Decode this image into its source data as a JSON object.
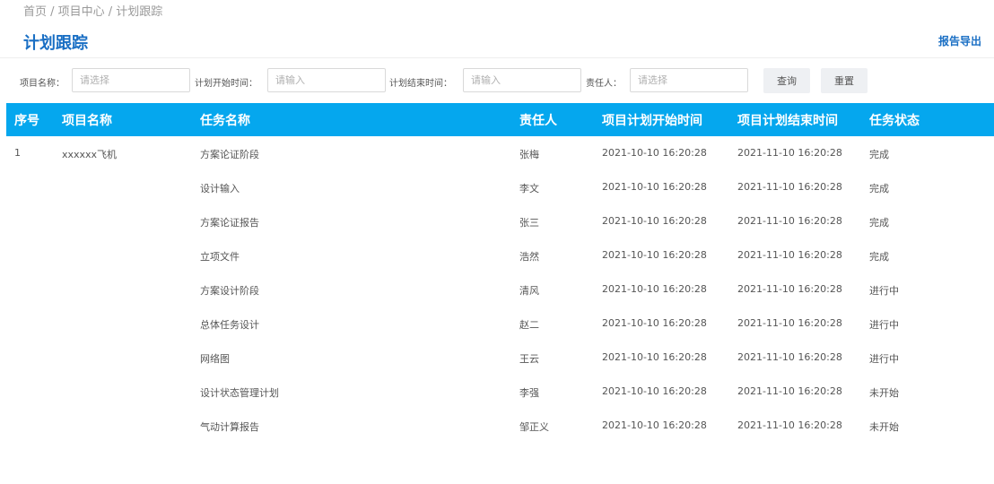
{
  "breadcrumb": "首页 / 项目中心 / 计划跟踪",
  "page_title": "计划跟踪",
  "export_label": "报告导出",
  "filters": {
    "project_name_label": "项目名称：",
    "project_name_placeholder": "请选择",
    "start_time_label": "计划开始时间：",
    "start_time_placeholder": "请输入",
    "end_time_label": "计划结束时间：",
    "end_time_placeholder": "请输入",
    "owner_label": "责任人：",
    "owner_placeholder": "请选择",
    "query_label": "查询",
    "reset_label": "重置"
  },
  "table": {
    "headers": {
      "seq": "序号",
      "project": "项目名称",
      "task": "任务名称",
      "owner": "责任人",
      "start": "项目计划开始时间",
      "end": "项目计划结束时间",
      "status": "任务状态"
    },
    "rows": [
      {
        "seq": "1",
        "project": "xxxxxx飞机",
        "task": "方案论证阶段",
        "owner": "张梅",
        "start": "2021-10-10 16:20:28",
        "end": "2021-11-10 16:20:28",
        "status": "完成"
      },
      {
        "seq": "",
        "project": "",
        "task": "设计输入",
        "owner": "李文",
        "start": "2021-10-10 16:20:28",
        "end": "2021-11-10 16:20:28",
        "status": "完成"
      },
      {
        "seq": "",
        "project": "",
        "task": "方案论证报告",
        "owner": "张三",
        "start": "2021-10-10 16:20:28",
        "end": "2021-11-10 16:20:28",
        "status": "完成"
      },
      {
        "seq": "",
        "project": "",
        "task": "立项文件",
        "owner": "浩然",
        "start": "2021-10-10 16:20:28",
        "end": "2021-11-10 16:20:28",
        "status": "完成"
      },
      {
        "seq": "",
        "project": "",
        "task": "方案设计阶段",
        "owner": "清风",
        "start": "2021-10-10 16:20:28",
        "end": "2021-11-10 16:20:28",
        "status": "进行中"
      },
      {
        "seq": "",
        "project": "",
        "task": "总体任务设计",
        "owner": "赵二",
        "start": "2021-10-10 16:20:28",
        "end": "2021-11-10 16:20:28",
        "status": "进行中"
      },
      {
        "seq": "",
        "project": "",
        "task": "网络图",
        "owner": "王云",
        "start": "2021-10-10 16:20:28",
        "end": "2021-11-10 16:20:28",
        "status": "进行中"
      },
      {
        "seq": "",
        "project": "",
        "task": "设计状态管理计划",
        "owner": "李强",
        "start": "2021-10-10 16:20:28",
        "end": "2021-11-10 16:20:28",
        "status": "未开始"
      },
      {
        "seq": "",
        "project": "",
        "task": "气动计算报告",
        "owner": "邹正义",
        "start": "2021-10-10 16:20:28",
        "end": "2021-11-10 16:20:28",
        "status": "未开始"
      }
    ]
  }
}
